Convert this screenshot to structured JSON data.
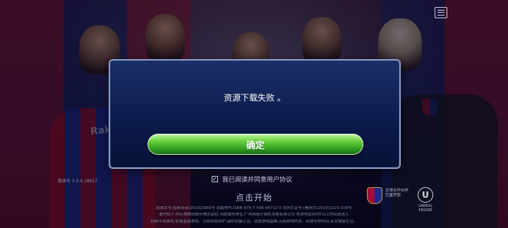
{
  "dialog": {
    "message": "资源下载失败 。",
    "confirm_label": "确定"
  },
  "footer": {
    "version": "版本号 3.3.0.18627",
    "agree_label": "我已阅读并同意用户协议",
    "agree_checked": true,
    "start_label": "点击开始",
    "legal_line1": "批准文号:国新出审[2019]2989号  出版物号:ISBN 978-7-498-06712-9  文网文证号:(署网文)2019]3223-108号",
    "legal_line2": "著作权人:科乐美数码娱乐株式会社  出版服务单位:广州网易计算机系统有限公司  本游戏适合8岁以上的玩家进入",
    "legal_line3": "抵制不良游戏,拒绝盗版游戏。注意自我保护,谨防受骗上当。适度游戏益脑,沉迷游戏伤身。合理安排时间,享受健康生活。"
  },
  "logos": {
    "fcb_caption": "全球合作伙伴 巴塞罗那",
    "unreal_caption": "UNREAL ENGINE",
    "unreal_glyph": "U",
    "sponsor_text": "Rakuten"
  },
  "icons": {
    "menu": "menu-icon",
    "check": "checkmark-icon"
  },
  "colors": {
    "confirm_green": "#4bb82c",
    "dialog_blue": "#0c1a4a"
  }
}
